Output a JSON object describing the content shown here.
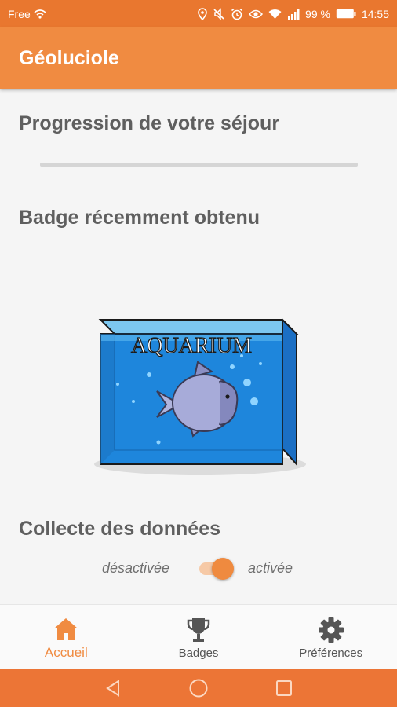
{
  "status_bar": {
    "carrier": "Free",
    "battery_text": "99 %",
    "time": "14:55",
    "icons": [
      "wifi-calling-icon",
      "location-icon",
      "mute-icon",
      "alarm-icon",
      "eye-icon",
      "wifi-icon",
      "signal-icon",
      "battery-icon"
    ]
  },
  "app_bar": {
    "title": "Géoluciole"
  },
  "progress": {
    "title": "Progression de votre séjour",
    "value_percent": 0
  },
  "badge": {
    "title": "Badge récemment obtenu",
    "name": "AQUARIUM"
  },
  "collecte": {
    "title": "Collecte des données",
    "label_off": "désactivée",
    "label_on": "activée",
    "enabled": true
  },
  "bottom_nav": {
    "items": [
      {
        "label": "Accueil",
        "icon": "home-icon",
        "active": true
      },
      {
        "label": "Badges",
        "icon": "trophy-icon",
        "active": false
      },
      {
        "label": "Préférences",
        "icon": "gear-icon",
        "active": false
      }
    ]
  },
  "system_nav": {
    "icons": [
      "back-icon",
      "home-circle-icon",
      "recents-icon"
    ]
  },
  "colors": {
    "accent": "#f08b41",
    "status_bar": "#e9772f",
    "system_nav": "#ec7536",
    "text": "#5f5f5f"
  }
}
